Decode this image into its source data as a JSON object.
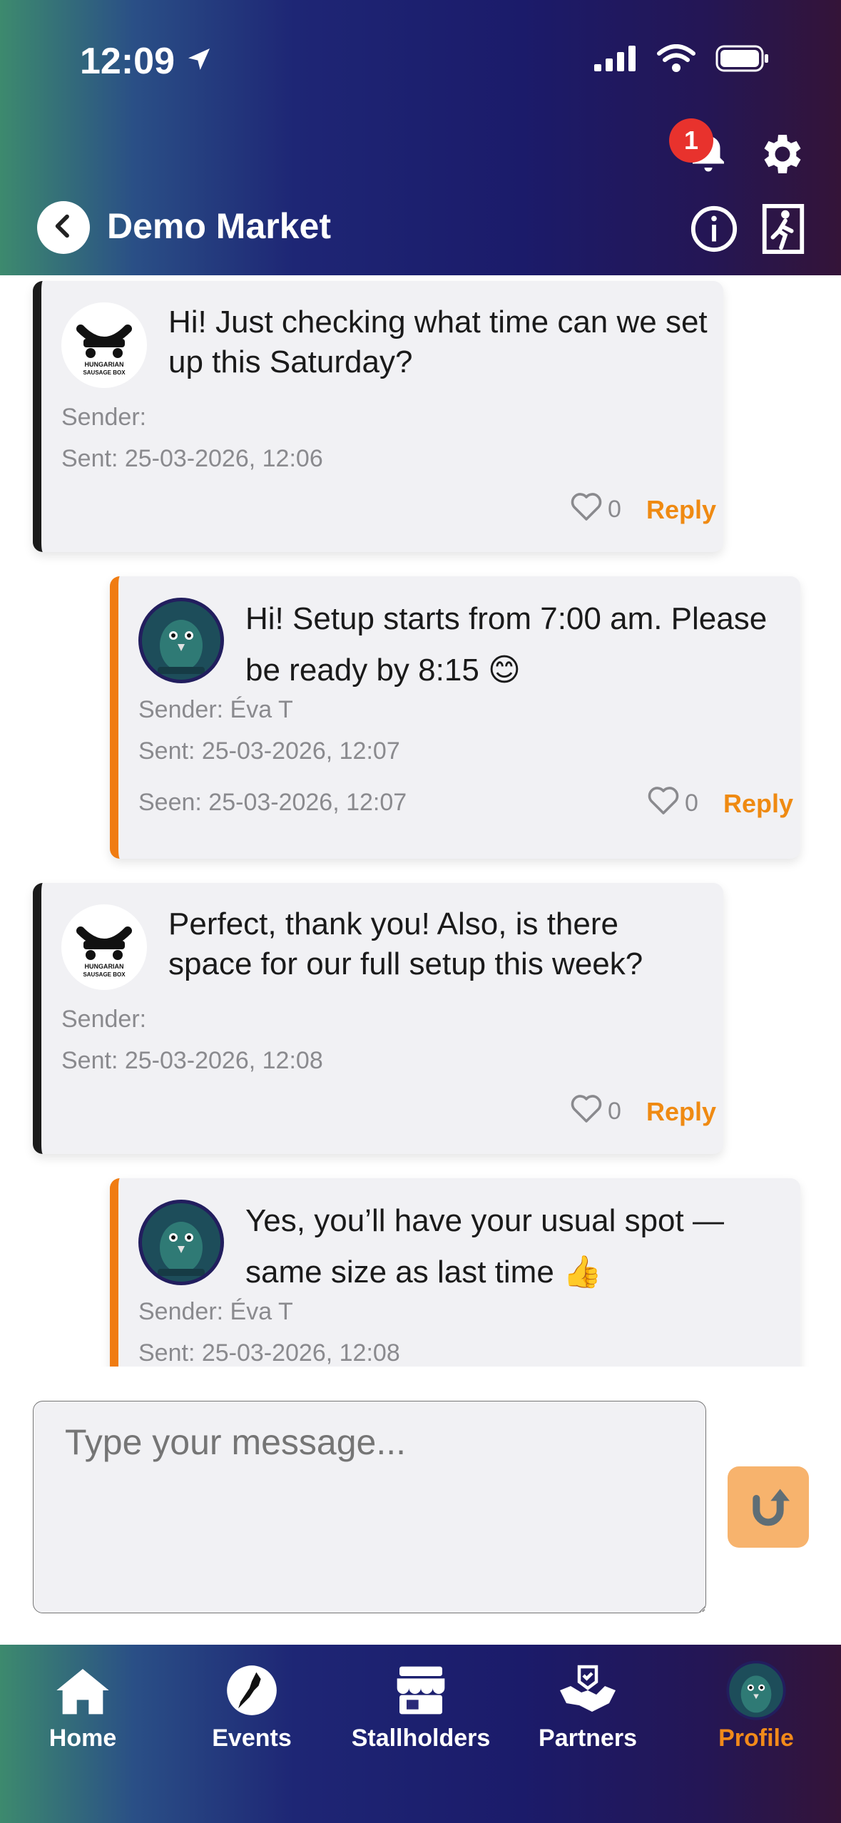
{
  "status_bar": {
    "time": "12:09"
  },
  "header": {
    "title": "Demo Market",
    "notification_count": "1",
    "icons": [
      "location-arrow-icon",
      "signal-icon",
      "wifi-icon",
      "battery-icon",
      "bell-icon",
      "gear-icon",
      "back-icon",
      "info-icon",
      "exit-icon"
    ]
  },
  "messages": [
    {
      "side": "left",
      "avatar": "Hungarian Sausage Box logo",
      "avatar_text": "HUNGARIAN SAUSAGE BOX",
      "text": "Hi! Just checking what time can we set up this Saturday?",
      "sender": "Sender:",
      "sent": "Sent: 25-03-2026, 12:06",
      "likes": "0",
      "reply": "Reply"
    },
    {
      "side": "right",
      "avatar": "owl mascot",
      "text": "Hi! Setup starts from 7:00 am. Please be ready by 8:15 😊",
      "sender": "Sender: Éva T",
      "sent": "Sent: 25-03-2026, 12:07",
      "seen": "Seen: 25-03-2026, 12:07",
      "likes": "0",
      "reply": "Reply"
    },
    {
      "side": "left",
      "avatar": "Hungarian Sausage Box logo",
      "avatar_text": "HUNGARIAN SAUSAGE BOX",
      "text": "Perfect, thank you! Also, is there space for our full setup this week?",
      "sender": "Sender:",
      "sent": "Sent: 25-03-2026, 12:08",
      "likes": "0",
      "reply": "Reply"
    },
    {
      "side": "right",
      "avatar": "owl mascot",
      "text": "Yes, you’ll have your usual spot — same size as last time 👍",
      "sender": "Sender: Éva T",
      "sent": "Sent: 25-03-2026, 12:08"
    }
  ],
  "composer": {
    "placeholder": "Type your message...",
    "send_icon": "send-arrow-icon"
  },
  "tabbar": {
    "tabs": [
      {
        "label": "Home",
        "icon": "home-icon"
      },
      {
        "label": "Events",
        "icon": "new-zealand-map-icon"
      },
      {
        "label": "Stallholders",
        "icon": "storefront-icon"
      },
      {
        "label": "Partners",
        "icon": "handshake-icon"
      },
      {
        "label": "Profile",
        "icon": "profile-avatar-icon",
        "active": true
      }
    ]
  },
  "colors": {
    "accent": "#f07c12",
    "reply": "#ef8a12",
    "badge": "#e8322d",
    "card": "#f1f1f4"
  }
}
